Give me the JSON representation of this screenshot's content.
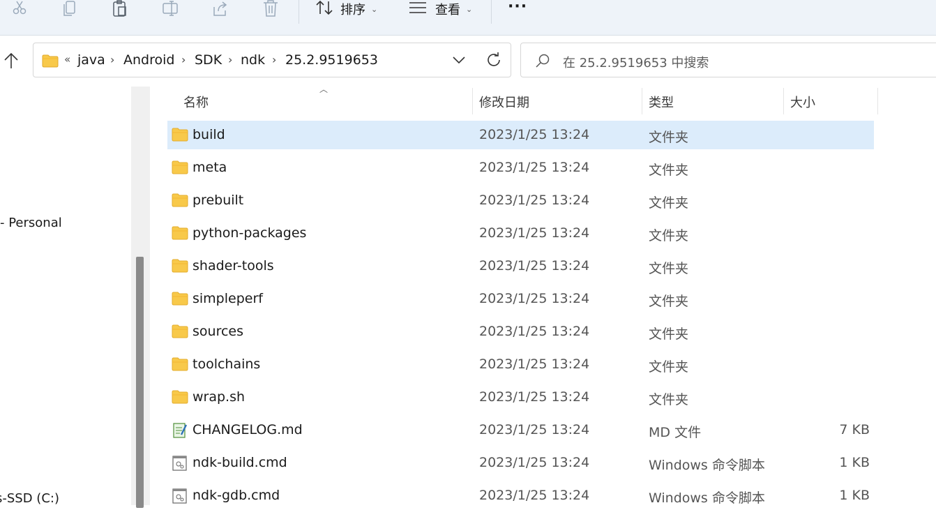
{
  "toolbar": {
    "icons": [
      "cut-icon",
      "copy-icon",
      "paste-icon",
      "rename-icon",
      "share-icon",
      "delete-icon"
    ],
    "sort_label": "排序",
    "view_label": "查看",
    "more_label": "···"
  },
  "address": {
    "overflow": "«",
    "crumbs": [
      "java",
      "Android",
      "SDK",
      "ndk",
      "25.2.9519653"
    ]
  },
  "search": {
    "placeholder": "在 25.2.9519653 中搜索"
  },
  "nav": {
    "items": [
      "- Personal",
      "s-SSD (C:)"
    ]
  },
  "columns": {
    "name": "名称",
    "date": "修改日期",
    "type": "类型",
    "size": "大小"
  },
  "files": [
    {
      "name": "build",
      "date": "2023/1/25 13:24",
      "type": "文件夹",
      "size": "",
      "icon": "folder-icon",
      "selected": true
    },
    {
      "name": "meta",
      "date": "2023/1/25 13:24",
      "type": "文件夹",
      "size": "",
      "icon": "folder-icon"
    },
    {
      "name": "prebuilt",
      "date": "2023/1/25 13:24",
      "type": "文件夹",
      "size": "",
      "icon": "folder-icon"
    },
    {
      "name": "python-packages",
      "date": "2023/1/25 13:24",
      "type": "文件夹",
      "size": "",
      "icon": "folder-icon"
    },
    {
      "name": "shader-tools",
      "date": "2023/1/25 13:24",
      "type": "文件夹",
      "size": "",
      "icon": "folder-icon"
    },
    {
      "name": "simpleperf",
      "date": "2023/1/25 13:24",
      "type": "文件夹",
      "size": "",
      "icon": "folder-icon"
    },
    {
      "name": "sources",
      "date": "2023/1/25 13:24",
      "type": "文件夹",
      "size": "",
      "icon": "folder-icon"
    },
    {
      "name": "toolchains",
      "date": "2023/1/25 13:24",
      "type": "文件夹",
      "size": "",
      "icon": "folder-icon"
    },
    {
      "name": "wrap.sh",
      "date": "2023/1/25 13:24",
      "type": "文件夹",
      "size": "",
      "icon": "folder-icon"
    },
    {
      "name": "CHANGELOG.md",
      "date": "2023/1/25 13:24",
      "type": "MD 文件",
      "size": "7 KB",
      "icon": "notepad-file-icon"
    },
    {
      "name": "ndk-build.cmd",
      "date": "2023/1/25 13:24",
      "type": "Windows 命令脚本",
      "size": "1 KB",
      "icon": "cmd-script-icon"
    },
    {
      "name": "ndk-gdb.cmd",
      "date": "2023/1/25 13:24",
      "type": "Windows 命令脚本",
      "size": "1 KB",
      "icon": "cmd-script-icon"
    }
  ],
  "colors": {
    "selection": "#dcecfb",
    "folder": "#f8c94a",
    "toolbar_bg": "#eef3f9"
  }
}
